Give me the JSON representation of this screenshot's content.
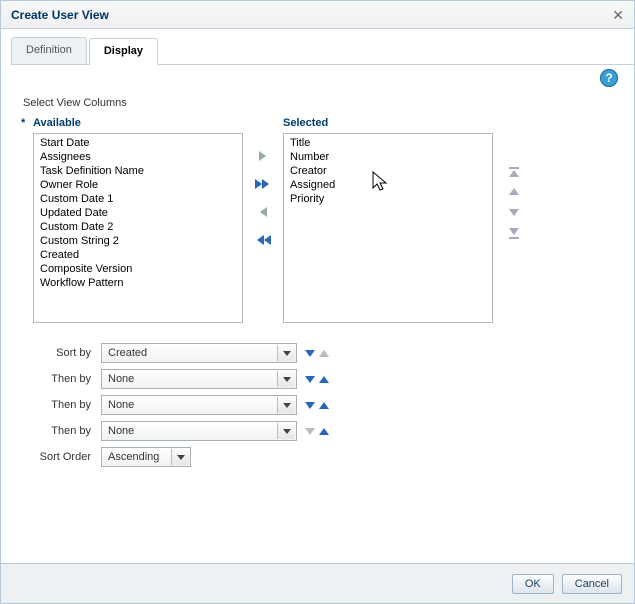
{
  "dialog": {
    "title": "Create User View"
  },
  "tabs": {
    "definition": "Definition",
    "display": "Display"
  },
  "section": {
    "select_view_columns": "Select View Columns"
  },
  "shuttle": {
    "required_mark": "*",
    "available_label": "Available",
    "selected_label": "Selected",
    "available_items": [
      "Start Date",
      "Assignees",
      "Task Definition Name",
      "Owner Role",
      "Custom Date 1",
      "Updated Date",
      "Custom Date 2",
      "Custom String 2",
      "Created",
      "Composite Version",
      "Workflow Pattern"
    ],
    "selected_items": [
      "Title",
      "Number",
      "Creator",
      "Assigned",
      "Priority"
    ]
  },
  "sort": {
    "rows": [
      {
        "label": "Sort by",
        "value": "Created",
        "down": "enabled",
        "up": "disabled"
      },
      {
        "label": "Then by",
        "value": "None",
        "down": "enabled",
        "up": "enabled"
      },
      {
        "label": "Then by",
        "value": "None",
        "down": "enabled",
        "up": "enabled"
      },
      {
        "label": "Then by",
        "value": "None",
        "down": "disabled",
        "up": "enabled"
      }
    ],
    "order_label": "Sort Order",
    "order_value": "Ascending"
  },
  "footer": {
    "ok": "OK",
    "cancel": "Cancel"
  },
  "help": "?"
}
